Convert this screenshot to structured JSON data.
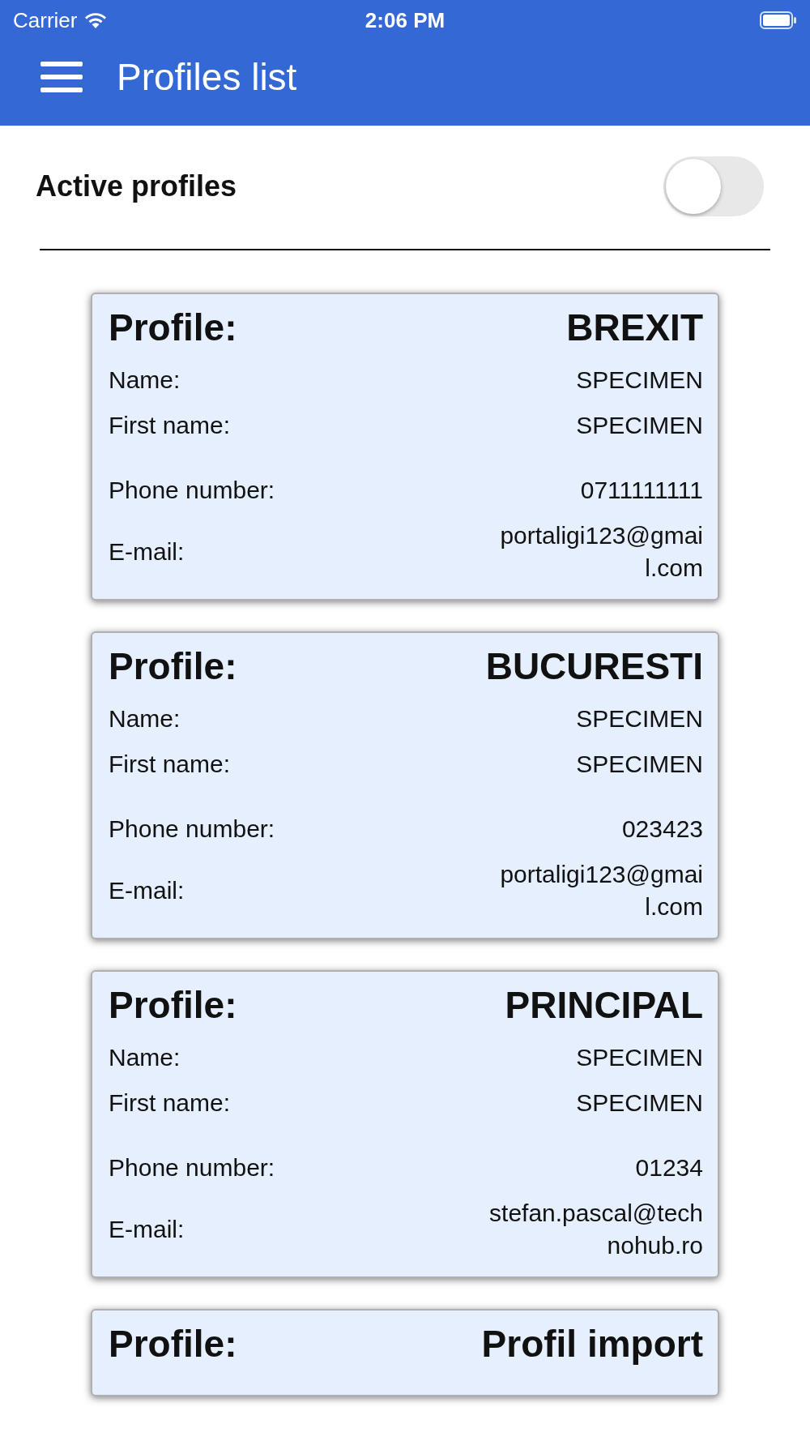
{
  "status_bar": {
    "carrier": "Carrier",
    "time": "2:06 PM"
  },
  "app_bar": {
    "title": "Profiles list"
  },
  "active_profiles": {
    "label": "Active profiles",
    "on": false
  },
  "profiles": [
    {
      "label": "Profile:",
      "profile": "BREXIT",
      "fields": [
        {
          "label": "Name:",
          "value": "SPECIMEN"
        },
        {
          "label": "First name:",
          "value": "SPECIMEN"
        },
        {
          "label": "Phone number:",
          "value": "0711111111"
        },
        {
          "label": "E-mail:",
          "value": "portaligi123@gmail.com"
        }
      ]
    },
    {
      "label": "Profile:",
      "profile": "BUCURESTI",
      "fields": [
        {
          "label": "Name:",
          "value": "SPECIMEN"
        },
        {
          "label": "First name:",
          "value": "SPECIMEN"
        },
        {
          "label": "Phone number:",
          "value": "023423"
        },
        {
          "label": "E-mail:",
          "value": "portaligi123@gmail.com"
        }
      ]
    },
    {
      "label": "Profile:",
      "profile": "PRINCIPAL",
      "fields": [
        {
          "label": "Name:",
          "value": "SPECIMEN"
        },
        {
          "label": "First name:",
          "value": "SPECIMEN"
        },
        {
          "label": "Phone number:",
          "value": "01234"
        },
        {
          "label": "E-mail:",
          "value": "stefan.pascal@technohub.ro"
        }
      ]
    },
    {
      "label": "Profile:",
      "profile": "Profil import"
    }
  ]
}
